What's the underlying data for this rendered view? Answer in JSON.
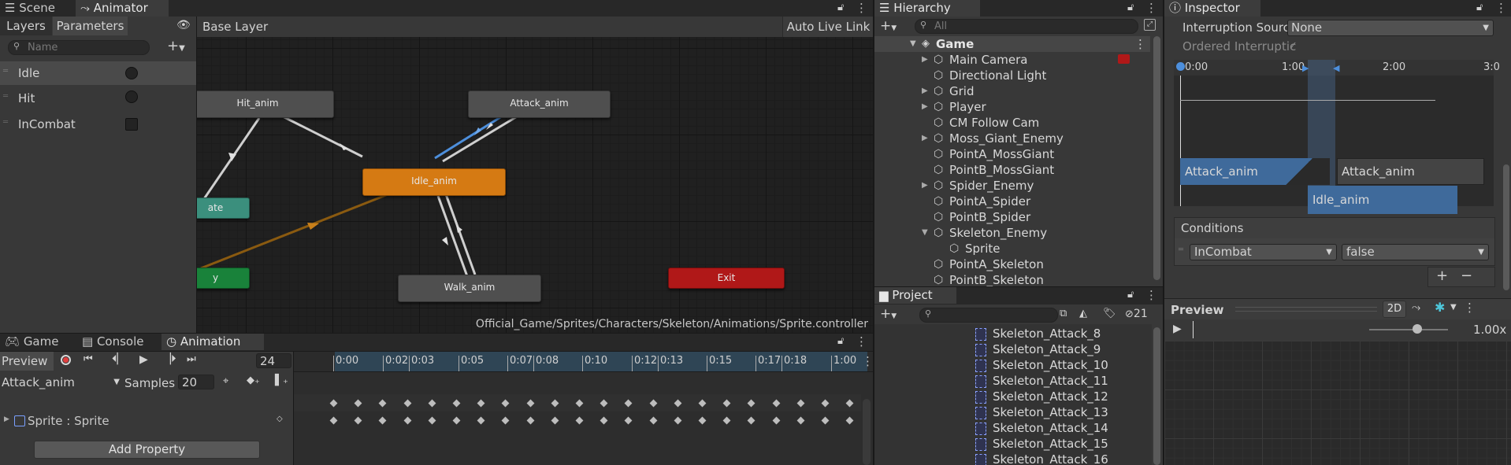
{
  "animator": {
    "tabs": [
      "Scene",
      "Animator"
    ],
    "subtabs": [
      "Layers",
      "Parameters"
    ],
    "search_placeholder": "Name",
    "breadcrumb": "Base Layer",
    "auto_live_link": "Auto Live Link",
    "path": "Official_Game/Sprites/Characters/Skeleton/Animations/Sprite.controller",
    "parameters": [
      {
        "name": "Idle",
        "type": "trigger"
      },
      {
        "name": "Hit",
        "type": "trigger"
      },
      {
        "name": "InCombat",
        "type": "bool"
      }
    ],
    "nodes": {
      "hit": "Hit_anim",
      "attack": "Attack_anim",
      "idle": "Idle_anim",
      "walk": "Walk_anim",
      "exit": "Exit",
      "any_state": "ate",
      "entry": "y"
    }
  },
  "hierarchy": {
    "title": "Hierarchy",
    "search_placeholder": "All",
    "scene": "Game",
    "items": [
      {
        "label": "Main Camera",
        "indent": 2,
        "arrow": true
      },
      {
        "label": "Directional Light",
        "indent": 2,
        "arrow": false
      },
      {
        "label": "Grid",
        "indent": 2,
        "arrow": true
      },
      {
        "label": "Player",
        "indent": 2,
        "arrow": true
      },
      {
        "label": "CM Follow Cam",
        "indent": 2,
        "arrow": false
      },
      {
        "label": "Moss_Giant_Enemy",
        "indent": 2,
        "arrow": true
      },
      {
        "label": "PointA_MossGiant",
        "indent": 2,
        "arrow": false
      },
      {
        "label": "PointB_MossGiant",
        "indent": 2,
        "arrow": false
      },
      {
        "label": "Spider_Enemy",
        "indent": 2,
        "arrow": true
      },
      {
        "label": "PointA_Spider",
        "indent": 2,
        "arrow": false
      },
      {
        "label": "PointB_Spider",
        "indent": 2,
        "arrow": false
      },
      {
        "label": "Skeleton_Enemy",
        "indent": 2,
        "arrow": "open"
      },
      {
        "label": "Sprite",
        "indent": 3,
        "arrow": false
      },
      {
        "label": "PointA_Skeleton",
        "indent": 2,
        "arrow": false
      },
      {
        "label": "PointB_Skeleton",
        "indent": 2,
        "arrow": false
      }
    ]
  },
  "project": {
    "title": "Project",
    "hidden_count": "21",
    "files": [
      "Skeleton_Attack_8",
      "Skeleton_Attack_9",
      "Skeleton_Attack_10",
      "Skeleton_Attack_11",
      "Skeleton_Attack_12",
      "Skeleton_Attack_13",
      "Skeleton_Attack_14",
      "Skeleton_Attack_15",
      "Skeleton_Attack_16"
    ]
  },
  "inspector": {
    "title": "Inspector",
    "interruption_label": "Interruption Sourc",
    "interruption_value": "None",
    "ordered_label": "Ordered Interruptic",
    "ordered_checked": true,
    "timeline_ticks": [
      "0:00",
      "1:00",
      "2:00",
      "3:0"
    ],
    "clip_attack_1": "Attack_anim",
    "clip_attack_2": "Attack_anim",
    "clip_idle": "Idle_anim",
    "conditions_title": "Conditions",
    "condition_param": "InCombat",
    "condition_value": "false",
    "preview_title": "Preview",
    "mode_2d": "2D",
    "speed": "1.00x"
  },
  "animation": {
    "tabs": [
      "Game",
      "Console",
      "Animation"
    ],
    "preview_label": "Preview",
    "frame": "24",
    "clip_name": "Attack_anim",
    "samples_label": "Samples",
    "samples_value": "20",
    "property": "Sprite : Sprite",
    "add_property": "Add Property",
    "ticks": [
      "0:00",
      "0:02",
      "0:03",
      "0:05",
      "0:07",
      "0:08",
      "0:10",
      "0:12",
      "0:13",
      "0:15",
      "0:17",
      "0:18",
      "1:00"
    ]
  },
  "colors": {
    "idle_node": "#d57a13",
    "exit_node": "#b01818",
    "entry_node": "#19823a",
    "any_node": "#3b8f7d",
    "selection": "#3d5b85",
    "clip_blue": "#3f6a9b"
  }
}
